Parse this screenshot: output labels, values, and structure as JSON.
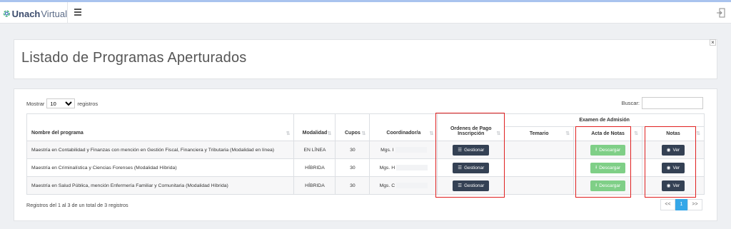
{
  "brand": {
    "bold": "Unach",
    "light": "Virtual"
  },
  "page_title": "Listado de Programas Aperturados",
  "close_label": "×",
  "length": {
    "prefix": "Mostrar",
    "selected": "10",
    "suffix": "registros"
  },
  "search": {
    "label": "Buscar:",
    "value": ""
  },
  "table": {
    "group_header": "Examen de Admisión",
    "headers": {
      "nombre": "Nombre del programa",
      "modalidad": "Modalidad",
      "cupos": "Cupos",
      "coordinador": "Coordinador/a",
      "ordenes": "Ordenes de Pago Inscripción",
      "temario": "Temario",
      "acta": "Acta de Notas",
      "notas": "Notas"
    },
    "rows": [
      {
        "nombre": "Maestría en Contabilidad y Finanzas con mención en Gestión Fiscal, Financiera y Tributaria (Modalidad en línea)",
        "modalidad": "EN LÍNEA",
        "cupos": "30",
        "coordinador": "Mgs. I"
      },
      {
        "nombre": "Maestría en Criminalística y Ciencias Forenses (Modalidad Híbrida)",
        "modalidad": "HÍBRIDA",
        "cupos": "30",
        "coordinador": "Mgs. H"
      },
      {
        "nombre": "Maestría en Salud Pública, mención Enfermería Familiar y Comunitaria (Modalidad Híbrida)",
        "modalidad": "HÍBRIDA",
        "cupos": "30",
        "coordinador": "Mgs. C"
      }
    ],
    "buttons": {
      "gestionar": "Gestionar",
      "descargar": "Descargar",
      "ver": "Ver"
    }
  },
  "info": "Registros del 1 al 3 de un total de 3 registros",
  "pager": {
    "prev": "<<",
    "current": "1",
    "next": ">>"
  },
  "colors": {
    "accent_dark": "#344154",
    "success": "#7fcf87",
    "pager_active": "#35a7e8",
    "highlight": "#e02020"
  }
}
